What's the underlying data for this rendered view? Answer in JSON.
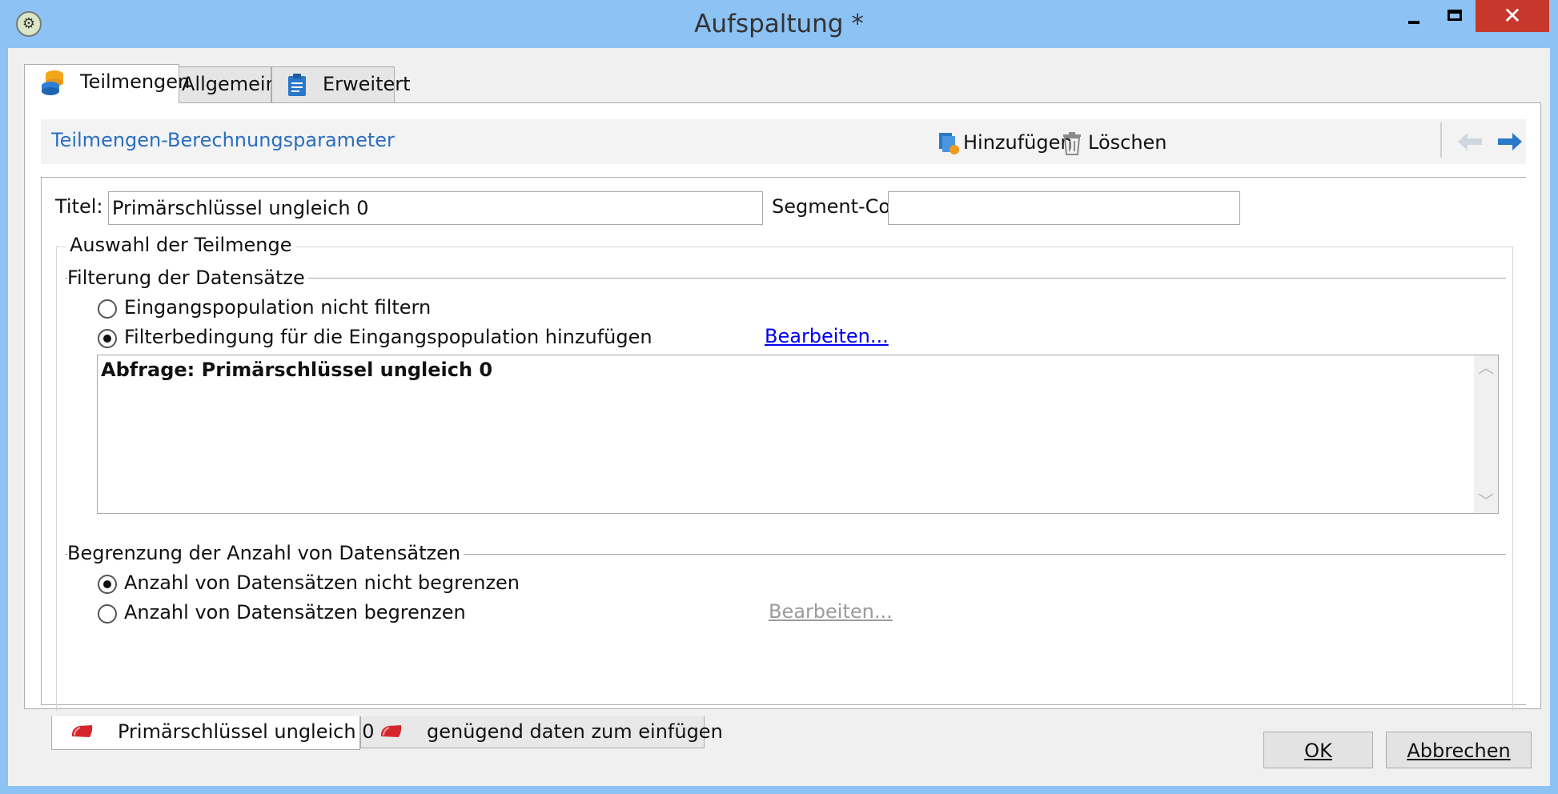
{
  "window": {
    "title": "Aufspaltung *",
    "controls": {
      "minimize_icon": "minimize-icon",
      "maximize_icon": "maximize-icon",
      "close_glyph": "✕"
    }
  },
  "tabs": [
    {
      "label": "Teilmengen",
      "icon": "database-icon",
      "active": true
    },
    {
      "label": "Allgemein",
      "active": false
    },
    {
      "label": "Erweitert",
      "icon": "clipboard-icon",
      "active": false
    }
  ],
  "section": {
    "title": "Teilmengen-Berechnungsparameter",
    "toolbar": {
      "add_label": "Hinzufügen",
      "delete_label": "Löschen"
    }
  },
  "form": {
    "title_label": "Titel:",
    "title_value": "Primärschlüssel ungleich 0",
    "segment_label": "Segment-Code:",
    "segment_value": ""
  },
  "selection": {
    "legend": "Auswahl der Teilmenge",
    "filter": {
      "legend": "Filterung der Datensätze",
      "options": [
        {
          "label": "Eingangspopulation nicht filtern",
          "checked": false
        },
        {
          "label": "Filterbedingung für die Eingangspopulation hinzufügen",
          "checked": true
        }
      ],
      "edit_link": "Bearbeiten...",
      "query_text": "Abfrage: Primärschlüssel ungleich 0"
    },
    "limit": {
      "legend": "Begrenzung der Anzahl von Datensätzen",
      "options": [
        {
          "label": "Anzahl von Datensätzen nicht begrenzen",
          "checked": true
        },
        {
          "label": "Anzahl von Datensätzen begrenzen",
          "checked": false
        }
      ],
      "edit_link": "Bearbeiten..."
    }
  },
  "subset_tabs": [
    {
      "label": "Primärschlüssel ungleich 0",
      "active": true
    },
    {
      "label": "genügend daten zum einfügen",
      "active": false
    }
  ],
  "buttons": {
    "ok": "OK",
    "cancel": "Abbrechen"
  },
  "colors": {
    "title_bar": "#8cc2f4",
    "close_button": "#c7372b",
    "section_title": "#2a6fc0",
    "link": "#0000ee",
    "subset_icon": "#d6262c"
  }
}
